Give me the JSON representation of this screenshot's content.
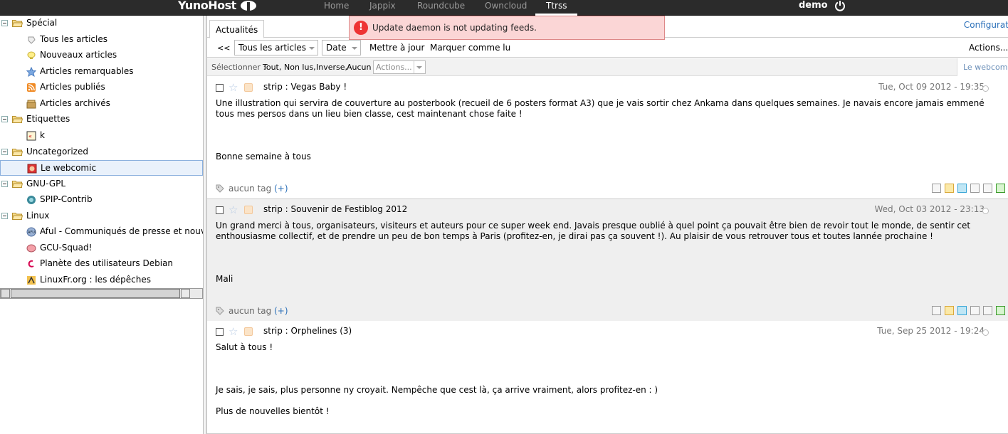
{
  "topbar": {
    "logo": "YunoHost",
    "nav": [
      {
        "label": "Home"
      },
      {
        "label": "Jappix"
      },
      {
        "label": "Roundcube"
      },
      {
        "label": "Owncloud"
      },
      {
        "label": "Ttrss"
      }
    ],
    "active_nav": "Ttrss",
    "user": "demo"
  },
  "sidebar": {
    "tree": [
      {
        "type": "category",
        "label": "Spécial"
      },
      {
        "type": "feed",
        "label": "Tous les articles",
        "icon": "all-articles-icon"
      },
      {
        "type": "feed",
        "label": "Nouveaux articles",
        "icon": "new-articles-icon"
      },
      {
        "type": "feed",
        "label": "Articles remarquables",
        "icon": "star-icon"
      },
      {
        "type": "feed",
        "label": "Articles publiés",
        "icon": "rss-icon"
      },
      {
        "type": "feed",
        "label": "Articles archivés",
        "icon": "archive-icon"
      },
      {
        "type": "category",
        "label": "Etiquettes"
      },
      {
        "type": "feed",
        "label": "k",
        "icon": "label-icon"
      },
      {
        "type": "category",
        "label": "Uncategorized"
      },
      {
        "type": "feed",
        "label": "Le webcomic",
        "icon": "webcomic-icon",
        "selected": true
      },
      {
        "type": "category",
        "label": "GNU-GPL"
      },
      {
        "type": "feed",
        "label": "SPIP-Contrib",
        "icon": "spip-icon"
      },
      {
        "type": "category",
        "label": "Linux"
      },
      {
        "type": "feed",
        "label": "Aful - Communiqués de presse et nouvelles",
        "icon": "aful-icon"
      },
      {
        "type": "feed",
        "label": "GCU-Squad!",
        "icon": "gcu-icon"
      },
      {
        "type": "feed",
        "label": "Planète des utilisateurs Debian",
        "icon": "debian-icon"
      },
      {
        "type": "feed",
        "label": "LinuxFr.org : les dépêches",
        "icon": "linuxfr-icon"
      }
    ]
  },
  "main": {
    "tab": "Actualités",
    "config_link": "Configurat",
    "notification": "Update daemon is not updating feeds.",
    "toolbar": {
      "back": "<<",
      "view_select": "Tous les articles",
      "order_select": "Date",
      "update": "Mettre à jour",
      "mark_read": "Marquer comme lu",
      "actions": "Actions..."
    },
    "selbar": {
      "label": "Sélectionner :",
      "links": [
        "Tout,",
        "Non lus,",
        "Inverse,",
        "Aucun"
      ],
      "actions_placeholder": "Actions...",
      "feed_title": "Le webcomic"
    },
    "articles": [
      {
        "title": "strip : Vegas Baby !",
        "date": "Tue, Oct 09 2012 - 19:35",
        "paragraphs": [
          "Une illustration qui servira de couverture au posterbook (recueil de 6 posters format A3) que je vais sortir chez Ankama dans quelques semaines. Je navais encore jamais emmené tous mes persos dans un lieu bien classe, cest maintenant chose faite !",
          "",
          "Bonne semaine à tous"
        ],
        "tags": "aucun tag",
        "tag_add": "(+)"
      },
      {
        "title": "strip : Souvenir de Festiblog 2012",
        "date": "Wed, Oct 03 2012 - 23:13",
        "paragraphs": [
          "Un grand merci à tous, organisateurs, visiteurs et auteurs pour ce super week end. Javais presque oublié à quel point ça pouvait être bien de revoir tout le monde, de sentir cet enthousiasme collectif, et de prendre un peu de bon temps à Paris (profitez-en, je dirai pas ça souvent !). Au plaisir de vous retrouver tous et toutes lannée prochaine !",
          "",
          "Mali"
        ],
        "tags": "aucun tag",
        "tag_add": "(+)"
      },
      {
        "title": "strip : Orphelines (3)",
        "date": "Tue, Sep 25 2012 - 19:24",
        "paragraphs": [
          "Salut à tous !",
          "",
          "Je sais, je sais, plus personne ny croyait. Nempêche que cest là, ça arrive vraiment, alors profitez-en : )",
          "Plus de nouvelles bientôt !"
        ]
      }
    ]
  }
}
